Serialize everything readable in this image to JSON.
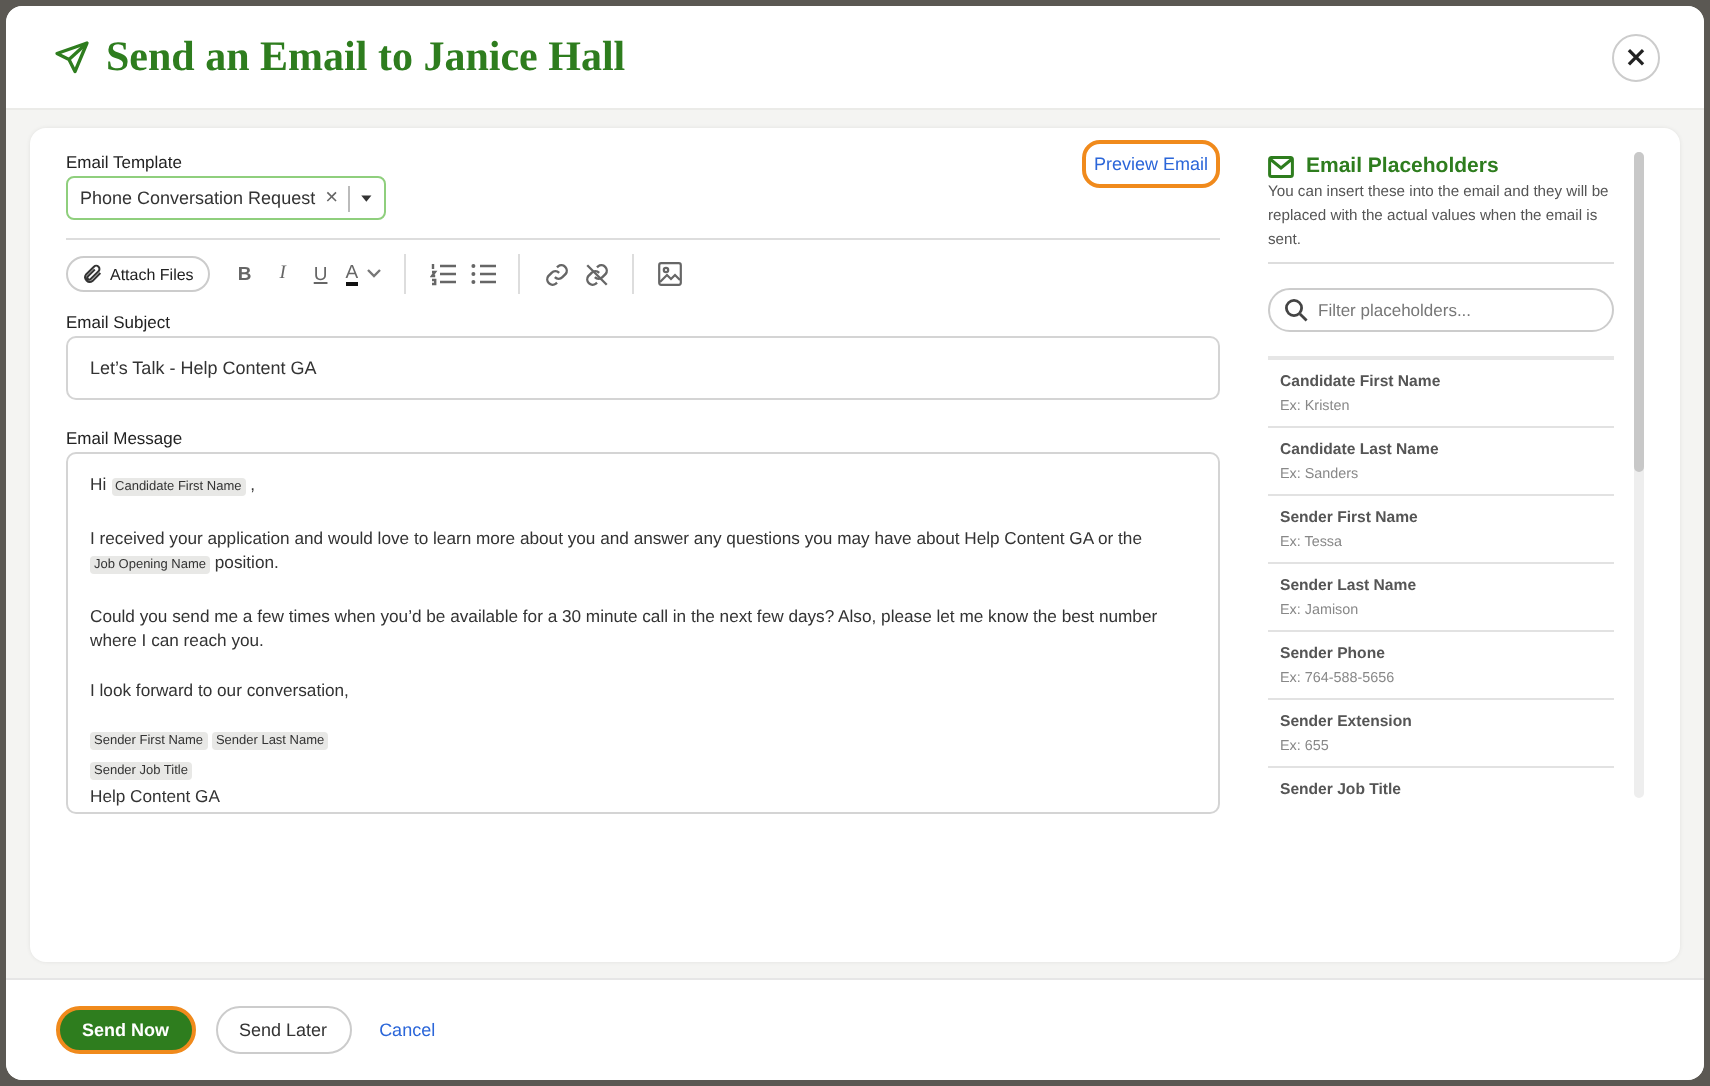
{
  "dialog": {
    "title": "Send an Email to Janice Hall",
    "close": "×"
  },
  "template": {
    "label": "Email Template",
    "value": "Phone Conversation Request",
    "clear": "×",
    "preview": "Preview Email"
  },
  "toolbar": {
    "attach": "Attach Files",
    "tools": [
      {
        "kind": "bold",
        "label": "B"
      },
      {
        "kind": "italic",
        "label": "I"
      },
      {
        "kind": "underline",
        "label": "U"
      },
      {
        "kind": "color",
        "label": "A"
      },
      {
        "kind": "divider"
      },
      {
        "kind": "ordered"
      },
      {
        "kind": "bullets"
      },
      {
        "kind": "divider"
      },
      {
        "kind": "link"
      },
      {
        "kind": "unlink"
      },
      {
        "kind": "divider"
      },
      {
        "kind": "image"
      }
    ]
  },
  "subject": {
    "label": "Email Subject",
    "value": "Let’s Talk - Help Content GA"
  },
  "message": {
    "label": "Email Message",
    "paragraphs": [
      [
        {
          "kind": "text",
          "text": "Hi"
        },
        {
          "kind": "token",
          "text": "Candidate First Name"
        },
        {
          "kind": "text",
          "text": ","
        }
      ],
      [
        {
          "kind": "text",
          "text": "I received your application and would love to learn more about you and answer any questions you may have about Help Content GA or the"
        },
        {
          "kind": "token",
          "text": "Job Opening Name"
        },
        {
          "kind": "text",
          "text": "position."
        }
      ],
      [
        {
          "kind": "text",
          "text": "Could you send me a few times when you’d be available for a 30 minute call in the next few days? Also, please let me know the best number where I can reach you."
        }
      ],
      [
        {
          "kind": "text",
          "text": "I look forward to our conversation,"
        }
      ],
      [
        {
          "kind": "token",
          "text": "Sender First Name"
        },
        {
          "kind": "token",
          "text": "Sender Last Name"
        },
        {
          "kind": "break"
        },
        {
          "kind": "token",
          "text": "Sender Job Title"
        },
        {
          "kind": "break"
        },
        {
          "kind": "text",
          "text": "Help Content GA"
        }
      ]
    ]
  },
  "placeholders": {
    "title": "Email Placeholders",
    "description": "You can insert these into the email and they will be replaced with the actual values when the email is sent.",
    "search": {
      "placeholder": "Filter placeholders..."
    },
    "items": [
      {
        "name": "Candidate First Name",
        "example": "Ex: Kristen"
      },
      {
        "name": "Candidate Last Name",
        "example": "Ex: Sanders"
      },
      {
        "name": "Sender First Name",
        "example": "Ex: Tessa"
      },
      {
        "name": "Sender Last Name",
        "example": "Ex: Jamison"
      },
      {
        "name": "Sender Phone",
        "example": "Ex: 764-588-5656"
      },
      {
        "name": "Sender Extension",
        "example": "Ex: 655"
      },
      {
        "name": "Sender Job Title"
      }
    ]
  },
  "footer": {
    "buttons": [
      {
        "kind": "primary",
        "label": "Send Now"
      },
      {
        "kind": "secondary",
        "label": "Send Later"
      },
      {
        "kind": "link",
        "label": "Cancel"
      }
    ]
  }
}
